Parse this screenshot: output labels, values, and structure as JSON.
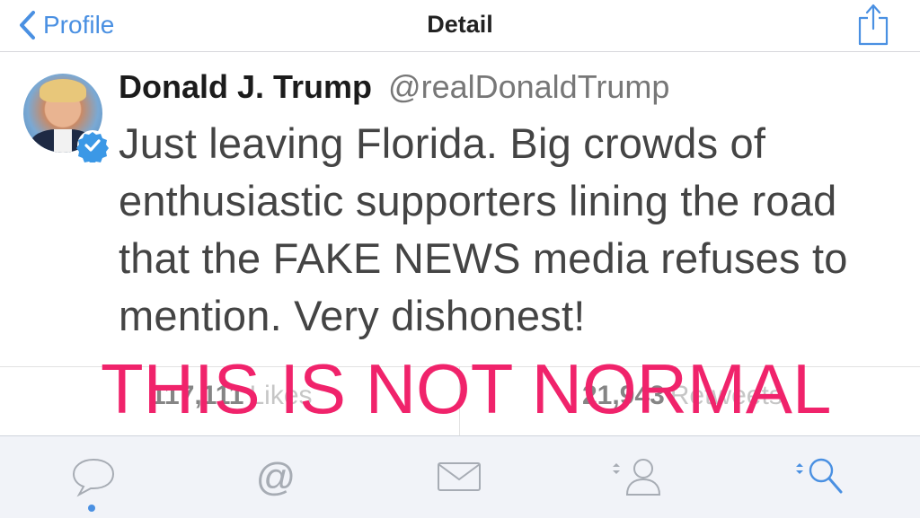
{
  "nav": {
    "back_label": "Profile",
    "title": "Detail"
  },
  "tweet": {
    "name": "Donald J. Trump",
    "handle": "@realDonaldTrump",
    "text": "Just leaving Florida. Big crowds of enthusiastic supporters lining the road that the FAKE NEWS media refuses to mention. Very dishonest!"
  },
  "stats": {
    "likes_count": "117,111",
    "likes_label": "Likes",
    "retweets_count": "21,943",
    "retweets_label": "Retweets"
  },
  "overlay_text": "THIS IS NOT NORMAL",
  "colors": {
    "accent": "#4a90e2",
    "overlay": "#f0236b"
  },
  "tabs": [
    {
      "icon": "speech-bubble-icon",
      "active": true
    },
    {
      "icon": "at-sign-icon",
      "active": false
    },
    {
      "icon": "envelope-icon",
      "active": false
    },
    {
      "icon": "person-icon",
      "active": false
    },
    {
      "icon": "search-icon",
      "active": false
    }
  ]
}
